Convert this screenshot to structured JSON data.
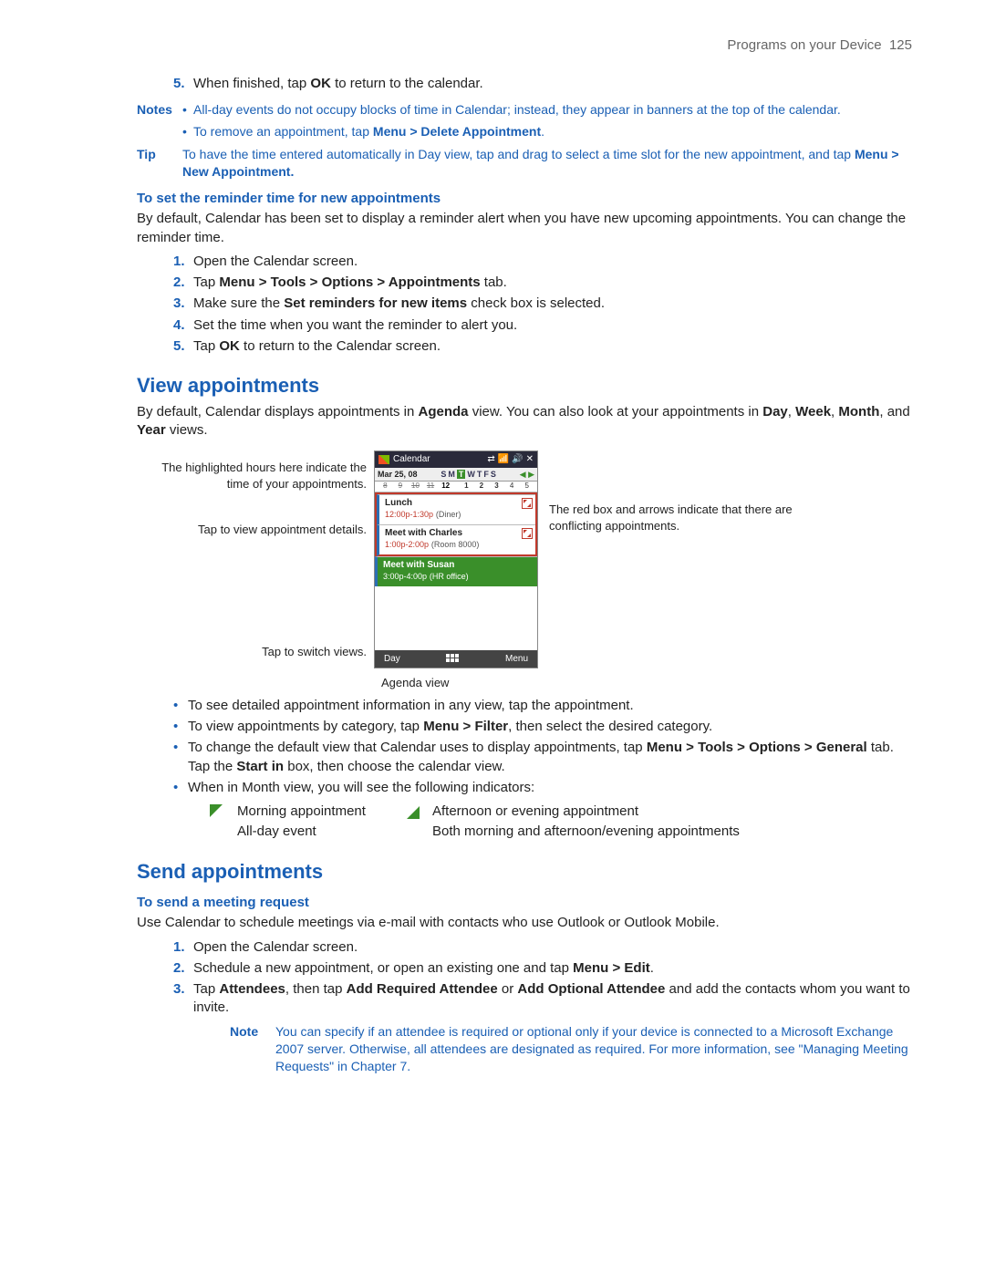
{
  "header": {
    "section": "Programs on your Device",
    "page": "125"
  },
  "step5_top": {
    "prefix": "When finished, tap ",
    "bold": "OK",
    "suffix": " to return to the calendar."
  },
  "notes_label": "Notes",
  "notes": {
    "n1": "All-day events do not occupy blocks of time in Calendar; instead, they appear in banners at the top of the calendar.",
    "n2_pre": "To remove an appointment, tap ",
    "n2_bold": "Menu > Delete Appointment",
    "n2_post": "."
  },
  "tip_label": "Tip",
  "tip": {
    "pre": "To have the time entered automatically in Day view, tap and drag to select a time slot for the new appointment, and tap ",
    "bold": "Menu > New Appointment."
  },
  "reminder": {
    "head": "To set the reminder time for new appointments",
    "body": "By default, Calendar has been set to display a reminder alert when you have new upcoming appointments. You can change the reminder time.",
    "s1": "Open the Calendar screen.",
    "s2_pre": "Tap ",
    "s2_bold": "Menu > Tools > Options > Appointments",
    "s2_post": " tab.",
    "s3_pre": "Make sure the ",
    "s3_bold": "Set reminders for new items",
    "s3_post": " check box is selected.",
    "s4": "Set the time when you want the reminder to alert you.",
    "s5_pre": "Tap ",
    "s5_bold": "OK",
    "s5_post": " to return to the Calendar screen."
  },
  "view": {
    "head": "View appointments",
    "body_pre": "By default, Calendar displays appointments in ",
    "body_b1": "Agenda",
    "body_mid": " view. You can also look at your appointments in ",
    "body_b2": "Day",
    "body_c1": ", ",
    "body_b3": "Week",
    "body_c2": ", ",
    "body_b4": "Month",
    "body_c3": ", and ",
    "body_b5": "Year",
    "body_post": " views."
  },
  "callouts": {
    "l1": "The highlighted hours here indicate the time of your appointments.",
    "l2": "Tap to view appointment details.",
    "l3": "Tap to switch views.",
    "r1": "The red box and arrows indicate that there are conflicting appointments."
  },
  "device": {
    "title": "Calendar",
    "date": "Mar 25, 08",
    "days": {
      "d0": "S",
      "d1": "M",
      "d2": "T",
      "d3": "W",
      "d4": "T",
      "d5": "F",
      "d6": "S"
    },
    "hours1": {
      "h0": "8",
      "h1": "9",
      "h2": "10",
      "h3": "11",
      "h4": "12"
    },
    "hours2": {
      "h0": "1",
      "h1": "2",
      "h2": "3",
      "h3": "4",
      "h4": "5"
    },
    "appt1": {
      "title": "Lunch",
      "time": "12:00p-1:30p",
      "loc": "(Diner)"
    },
    "appt2": {
      "title": "Meet with Charles",
      "time": "1:00p-2:00p",
      "loc": "(Room 8000)"
    },
    "appt3": {
      "title": "Meet with Susan",
      "time": "3:00p-4:00p",
      "loc": "(HR office)"
    },
    "bottom_left": "Day",
    "bottom_right": "Menu",
    "caption": "Agenda view"
  },
  "view_bullets": {
    "b1": "To see detailed appointment information in any view, tap the appointment.",
    "b2_pre": "To view appointments by category, tap ",
    "b2_bold": "Menu > Filter",
    "b2_post": ", then select the desired category.",
    "b3_pre": "To change the default view that Calendar uses to display appointments, tap ",
    "b3_bold1": "Menu > Tools > Options > General",
    "b3_mid": " tab. Tap the ",
    "b3_bold2": "Start in",
    "b3_post": " box, then choose the calendar view.",
    "b4": "When in Month view, you will see the following indicators:"
  },
  "indicators": {
    "morning": "Morning appointment",
    "afternoon": "Afternoon or evening appointment",
    "allday": "All-day event",
    "both": "Both morning and afternoon/evening appointments"
  },
  "send": {
    "head": "Send appointments",
    "sub": "To send a meeting request",
    "body": "Use Calendar to schedule meetings via e-mail with contacts who use Outlook or Outlook Mobile.",
    "s1": "Open the Calendar screen.",
    "s2_pre": "Schedule a new appointment, or open an existing one and tap ",
    "s2_bold": "Menu > Edit",
    "s2_post": ".",
    "s3_pre": "Tap ",
    "s3_b1": "Attendees",
    "s3_mid1": ", then tap ",
    "s3_b2": "Add Required Attendee",
    "s3_mid2": " or ",
    "s3_b3": "Add Optional Attendee",
    "s3_post": " and add the contacts whom you want to invite.",
    "note_label": "Note",
    "note": "You can specify if an attendee is required or optional only if your device is connected to a Microsoft Exchange 2007 server. Otherwise, all attendees are designated as required. For more information, see \"Managing Meeting Requests\" in Chapter 7."
  },
  "nums": {
    "n1": "1.",
    "n2": "2.",
    "n3": "3.",
    "n4": "4.",
    "n5": "5."
  }
}
